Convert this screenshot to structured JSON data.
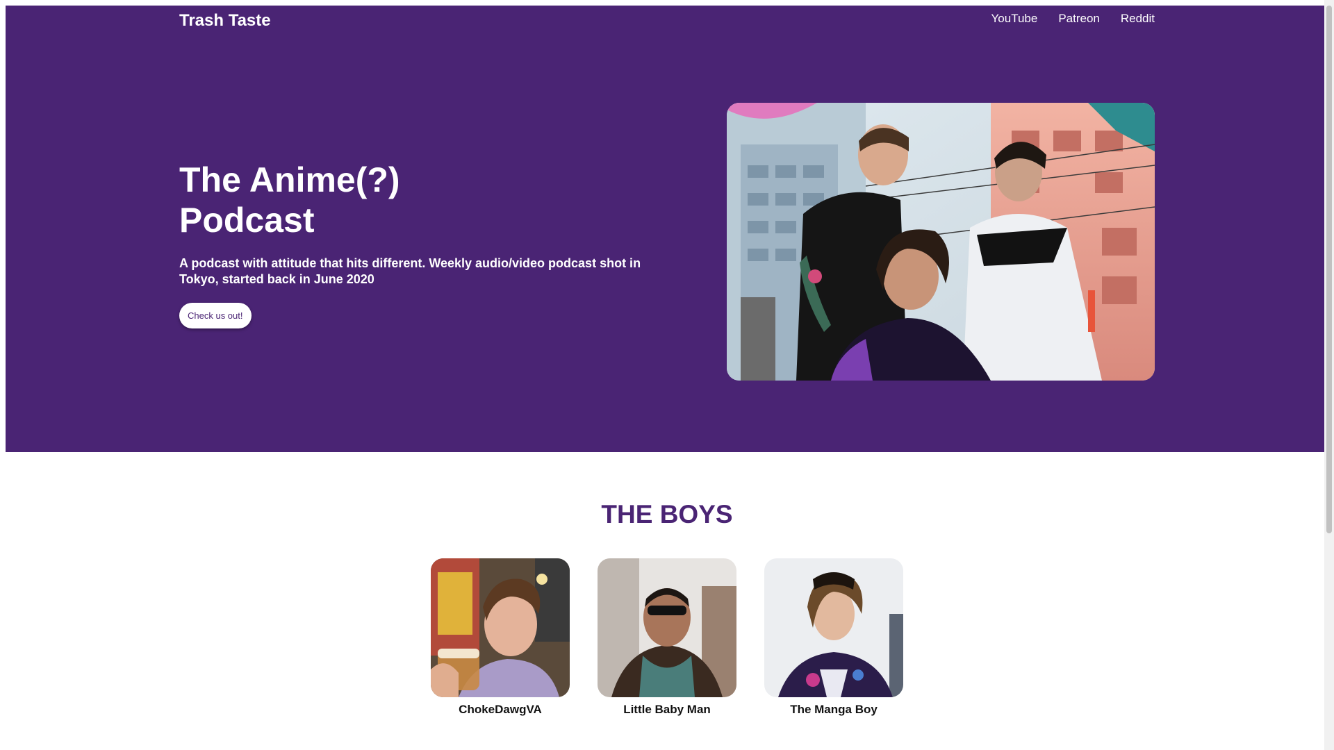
{
  "nav": {
    "brand": "Trash Taste",
    "links": [
      "YouTube",
      "Patreon",
      "Reddit"
    ]
  },
  "hero": {
    "title_line1": "The Anime(?)",
    "title_line2": "Podcast",
    "subtitle": "A podcast with attitude that hits different. Weekly audio/video podcast shot in Tokyo, started back in June 2020",
    "cta_label": "Check us out!"
  },
  "boys": {
    "heading": "THE BOYS",
    "members": [
      {
        "name": "ChokeDawgVA"
      },
      {
        "name": "Little Baby Man"
      },
      {
        "name": "The Manga Boy"
      }
    ]
  },
  "colors": {
    "brand_purple": "#4a2474",
    "background": "#ffffff",
    "text_dark": "#111111"
  }
}
